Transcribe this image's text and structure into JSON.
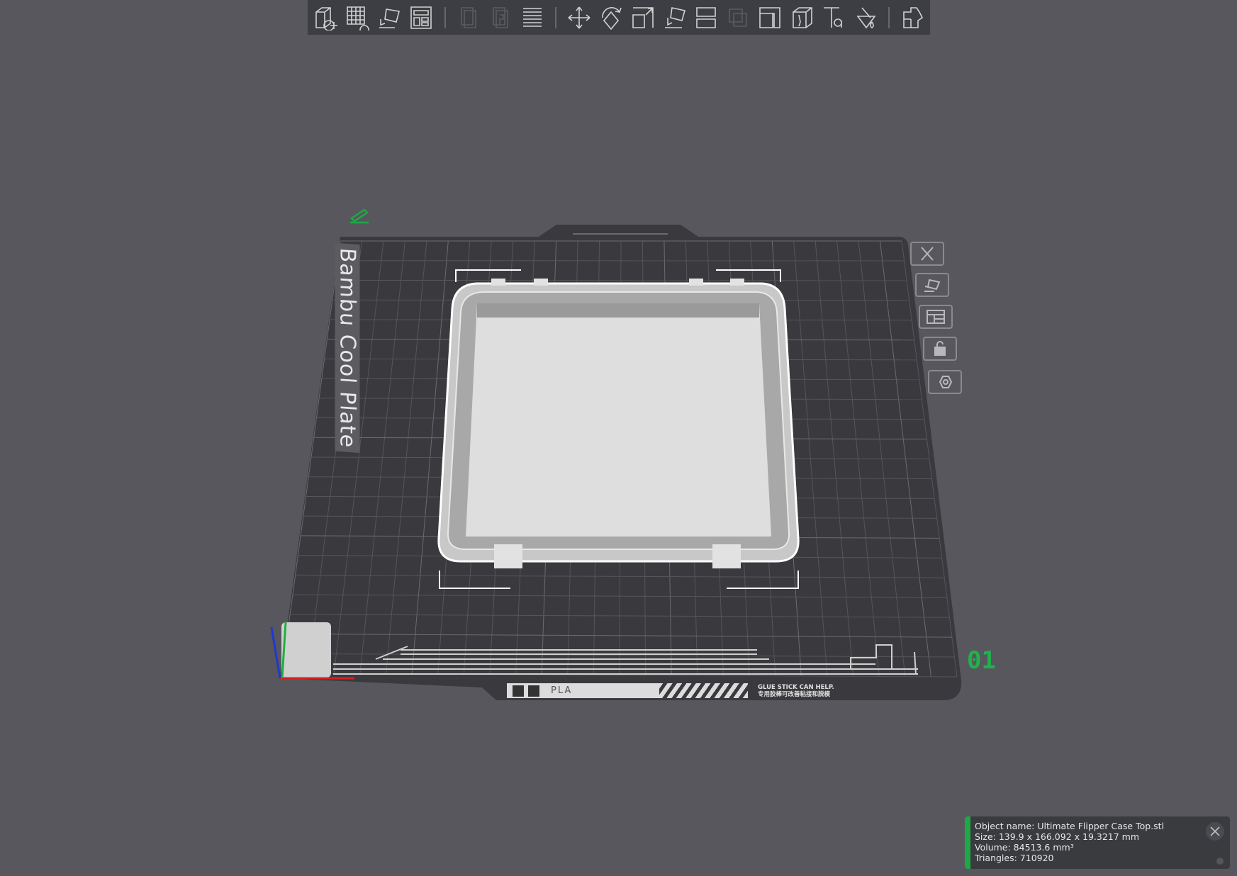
{
  "toolbar": {
    "groups": [
      [
        "add-object",
        "add-plate",
        "auto-orient",
        "arrange"
      ],
      [
        "split-objects",
        "split-parts",
        "layers"
      ],
      [
        "move",
        "rotate",
        "scale",
        "lay-on-face",
        "cut",
        "boolean",
        "support-paint",
        "seam-paint",
        "text",
        "color-paint"
      ],
      [
        "assembly"
      ]
    ],
    "disabled": [
      "split-objects",
      "split-parts",
      "boolean"
    ]
  },
  "plate": {
    "name": "Bambu Cool Plate",
    "number": "01",
    "material": "PLA",
    "tip_en": "GLUE STICK CAN HELP.",
    "tip_cn": "专用胶棒可改善粘接和脱模",
    "side_buttons": [
      "close-plate",
      "auto-orient-plate",
      "arrange-plate",
      "lock-plate",
      "plate-settings"
    ]
  },
  "object_info": {
    "name": "Object name: Ultimate Flipper Case Top.stl",
    "size": "Size: 139.9 x 166.092 x 19.3217 mm",
    "volume": "Volume: 84513.6 mm³",
    "triangles": "Triangles: 710920"
  },
  "colors": {
    "background": "#57575d",
    "plate": "#3a3a3e",
    "accent": "#1ea846",
    "model": "#d6d6d6"
  }
}
